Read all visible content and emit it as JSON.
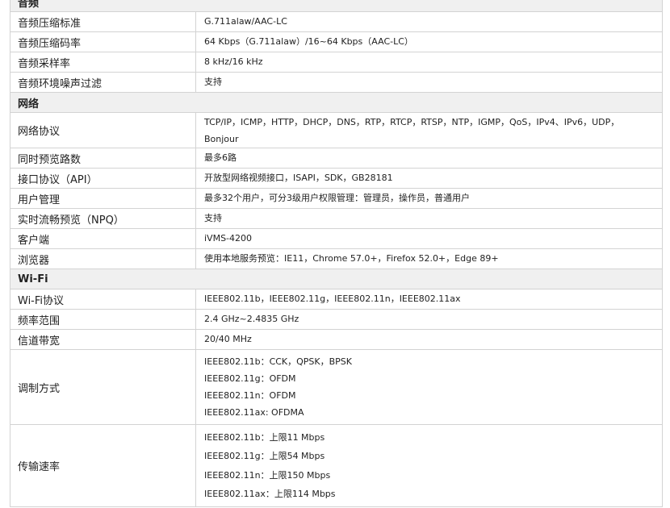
{
  "rows": [
    {
      "type": "section",
      "label": "音频"
    },
    {
      "type": "row",
      "label": "音频压缩标准",
      "lines": [
        "G.711alaw/AAC-LC"
      ],
      "h": 25
    },
    {
      "type": "row",
      "label": "音频压缩码率",
      "lines": [
        "64 Kbps（G.711alaw）/16~64 Kbps（AAC-LC）"
      ],
      "h": 25
    },
    {
      "type": "row",
      "label": "音频采样率",
      "lines": [
        "8 kHz/16 kHz"
      ],
      "h": 25
    },
    {
      "type": "row",
      "label": "音频环境噪声过滤",
      "lines": [
        "支持"
      ],
      "h": 25
    },
    {
      "type": "section",
      "label": "网络"
    },
    {
      "type": "row",
      "label": "网络协议",
      "lines": [
        "TCP/IP，ICMP，HTTP，DHCP，DNS，RTP，RTCP，RTSP，NTP，IGMP，QoS，IPv4、IPv6，UDP，",
        "Bonjour"
      ],
      "h": 44,
      "cls": "lines-wrap"
    },
    {
      "type": "row",
      "label": "同时预览路数",
      "lines": [
        "最多6路"
      ],
      "h": 25
    },
    {
      "type": "row",
      "label": "接口协议（API）",
      "lines": [
        "开放型网络视频接口，ISAPI，SDK，GB28181"
      ],
      "h": 25
    },
    {
      "type": "row",
      "label": "用户管理",
      "lines": [
        "最多32个用户，可分3级用户权限管理：管理员，操作员，普通用户"
      ],
      "h": 25
    },
    {
      "type": "row",
      "label": "实时流畅预览（NPQ）",
      "lines": [
        "支持"
      ],
      "h": 25
    },
    {
      "type": "row",
      "label": "客户端",
      "lines": [
        "iVMS-4200"
      ],
      "h": 25
    },
    {
      "type": "row",
      "label": "浏览器",
      "lines": [
        "使用本地服务预览：IE11，Chrome 57.0+，Firefox 52.0+，Edge 89+"
      ],
      "h": 25
    },
    {
      "type": "section",
      "label": "Wi-Fi"
    },
    {
      "type": "row",
      "label": "Wi-Fi协议",
      "lines": [
        "IEEE802.11b，IEEE802.11g，IEEE802.11n，IEEE802.11ax"
      ],
      "h": 25
    },
    {
      "type": "row",
      "label": "频率范围",
      "lines": [
        "2.4 GHz~2.4835 GHz"
      ],
      "h": 25
    },
    {
      "type": "row",
      "label": "信道带宽",
      "lines": [
        "20/40 MHz"
      ],
      "h": 25
    },
    {
      "type": "row",
      "label": "调制方式",
      "lines": [
        "IEEE802.11b：CCK，QPSK，BPSK",
        "IEEE802.11g：OFDM",
        "IEEE802.11n：OFDM",
        "IEEE802.11ax: OFDMA"
      ],
      "h": 93,
      "cls": "lines-tight"
    },
    {
      "type": "row",
      "label": "传输速率",
      "lines": [
        "IEEE802.11b：上限11 Mbps",
        "IEEE802.11g：上限54 Mbps",
        "IEEE802.11n：上限150 Mbps",
        "IEEE802.11ax：上限114 Mbps"
      ],
      "h": 102,
      "cls": "lines-wide"
    }
  ]
}
